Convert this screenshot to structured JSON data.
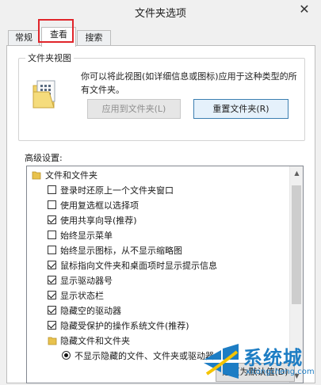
{
  "window": {
    "title": "文件夹选项",
    "close_icon": "close-icon"
  },
  "tabs": [
    {
      "label": "常规",
      "active": false
    },
    {
      "label": "查看",
      "active": true
    },
    {
      "label": "搜索",
      "active": false
    }
  ],
  "folder_views": {
    "label": "文件夹视图",
    "description": "你可以将此视图(如详细信息或图标)应用于这种类型的所有文件夹。",
    "apply_button": "应用到文件夹(L)",
    "reset_button": "重置文件夹(R)"
  },
  "advanced": {
    "label": "高级设置:",
    "items": [
      {
        "type": "folder",
        "label": "文件和文件夹"
      },
      {
        "type": "checkbox",
        "label": "登录时还原上一个文件夹窗口",
        "checked": false
      },
      {
        "type": "checkbox",
        "label": "使用复选框以选择项",
        "checked": false
      },
      {
        "type": "checkbox",
        "label": "使用共享向导(推荐)",
        "checked": true
      },
      {
        "type": "checkbox",
        "label": "始终显示菜单",
        "checked": false
      },
      {
        "type": "checkbox",
        "label": "始终显示图标，从不显示缩略图",
        "checked": false
      },
      {
        "type": "checkbox",
        "label": "鼠标指向文件夹和桌面项时显示提示信息",
        "checked": true
      },
      {
        "type": "checkbox",
        "label": "显示驱动器号",
        "checked": true
      },
      {
        "type": "checkbox",
        "label": "显示状态栏",
        "checked": true
      },
      {
        "type": "checkbox",
        "label": "隐藏空的驱动器",
        "checked": true
      },
      {
        "type": "checkbox",
        "label": "隐藏受保护的操作系统文件(推荐)",
        "checked": true
      },
      {
        "type": "folder",
        "label": "隐藏文件和文件夹"
      },
      {
        "type": "radio",
        "label": "不显示隐藏的文件、文件夹或驱动器",
        "checked": true
      }
    ]
  },
  "restore_button": "还原为默认值(D)",
  "watermark": {
    "text": "系统城",
    "url": "xitongcheng.com"
  },
  "colors": {
    "accent": "#1d7dc4",
    "highlight": "#e0252b"
  }
}
